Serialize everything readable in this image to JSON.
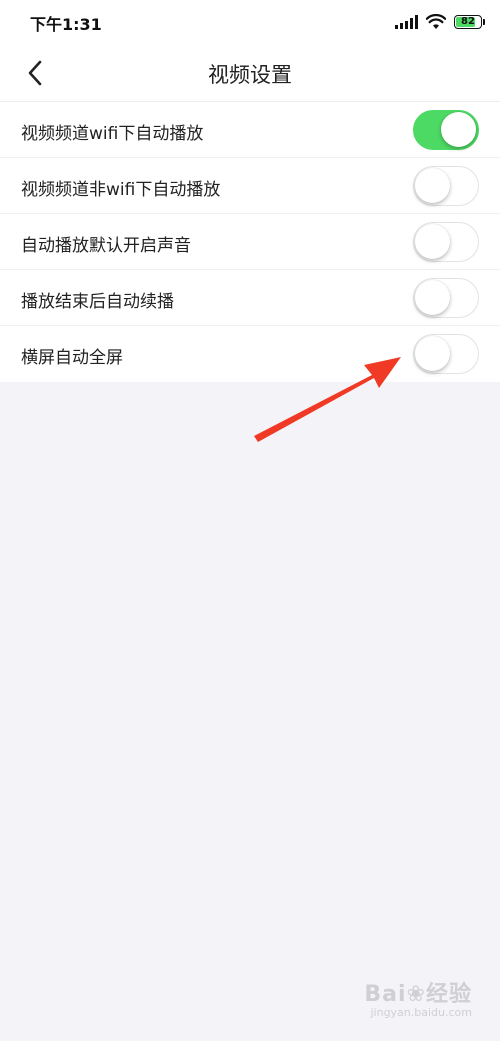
{
  "status_bar": {
    "time": "下午1:31",
    "battery_level": 82,
    "battery_text": "82",
    "icons": [
      "signal-icon",
      "wifi-icon",
      "battery-icon"
    ]
  },
  "nav": {
    "title": "视频设置",
    "back_icon": "chevron-left-icon"
  },
  "settings": [
    {
      "label": "视频频道wifi下自动播放",
      "enabled": true
    },
    {
      "label": "视频频道非wifi下自动播放",
      "enabled": false
    },
    {
      "label": "自动播放默认开启声音",
      "enabled": false
    },
    {
      "label": "播放结束后自动续播",
      "enabled": false
    },
    {
      "label": "横屏自动全屏",
      "enabled": false
    }
  ],
  "colors": {
    "toggle_on": "#4cd964",
    "toggle_off": "#ffffff",
    "page_background": "#f4f4f8",
    "annotation_arrow": "#f03a26"
  },
  "watermark": {
    "logo": "Bai",
    "logo_suffix": "经验",
    "url": "jingyan.baidu.com"
  }
}
